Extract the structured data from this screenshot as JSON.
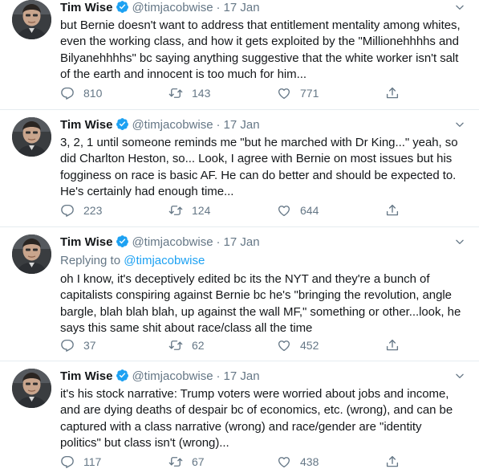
{
  "colors": {
    "link": "#1da1f2",
    "muted": "#657786",
    "text": "#14171a",
    "divider": "#e6ecf0"
  },
  "icons": [
    "verified-badge-icon",
    "chevron-down-icon",
    "reply-icon",
    "retweet-icon",
    "like-icon",
    "share-icon"
  ],
  "tweets": [
    {
      "name": "Tim Wise",
      "handle": "@timjacobwise",
      "dot": "·",
      "date": "17 Jan",
      "replying_label": "",
      "replying_handle": "",
      "text": "but Bernie doesn't want to address that entitlement mentality among whites,\neven the working class, and how it gets exploited by the \"Millionehhhhs and\nBilyanehhhhs\" bc saying anything suggestive that the white worker isn't salt\nof the earth and innocent is too much for him...",
      "replies": "810",
      "retweets": "143",
      "likes": "771"
    },
    {
      "name": "Tim Wise",
      "handle": "@timjacobwise",
      "dot": "·",
      "date": "17 Jan",
      "replying_label": "",
      "replying_handle": "",
      "text": "3, 2, 1 until someone reminds me \"but he marched with Dr King...\" yeah, so\ndid Charlton Heston, so... Look, I agree with Bernie on most issues but his\nfogginess on race is basic AF. He can do better and should be expected to.\nHe's certainly had enough time...",
      "replies": "223",
      "retweets": "124",
      "likes": "644"
    },
    {
      "name": "Tim Wise",
      "handle": "@timjacobwise",
      "dot": "·",
      "date": "17 Jan",
      "replying_label": "Replying to ",
      "replying_handle": "@timjacobwise",
      "text": "oh I know, it's deceptively edited bc its the NYT and they're a bunch of\ncapitalists conspiring against Bernie bc he's \"bringing the revolution, angle\nbargle, blah blah blah, up against the wall MF,\" something or other...look, he\nsays this same shit about race/class all the time",
      "replies": "37",
      "retweets": "62",
      "likes": "452"
    },
    {
      "name": "Tim Wise",
      "handle": "@timjacobwise",
      "dot": "·",
      "date": "17 Jan",
      "replying_label": "",
      "replying_handle": "",
      "text": "it's his stock narrative: Trump voters were worried about jobs and income,\nand are dying deaths of despair bc of economics, etc. (wrong), and can be\ncaptured with a class narrative (wrong) and race/gender are \"identity\npolitics\" but class isn't (wrong)...",
      "replies": "117",
      "retweets": "67",
      "likes": "438"
    }
  ]
}
